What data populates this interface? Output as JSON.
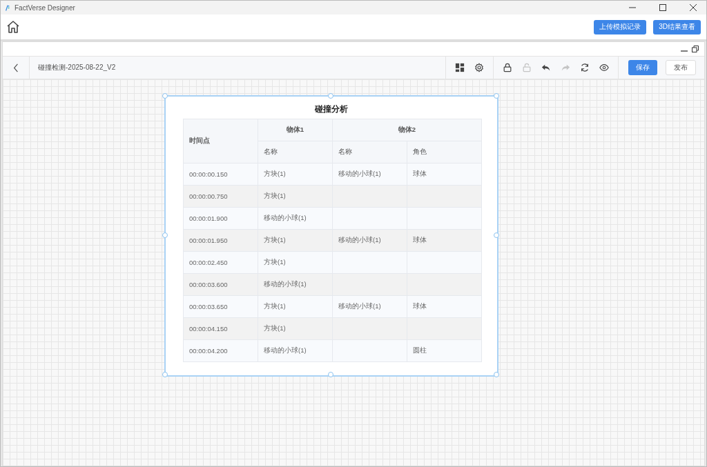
{
  "window": {
    "title": "FactVerse Designer"
  },
  "header": {
    "buttons": [
      "上传模拟记录",
      "3D结果查看"
    ]
  },
  "toolbar": {
    "document_title": "碰撞检测-2025-08-22_V2",
    "tools": [
      {
        "kind": "layout",
        "disabled": false
      },
      {
        "kind": "settings",
        "disabled": false
      },
      {
        "kind": "lock",
        "disabled": false
      },
      {
        "kind": "unlock",
        "disabled": true
      },
      {
        "kind": "undo",
        "disabled": false
      },
      {
        "kind": "redo",
        "disabled": true
      },
      {
        "kind": "refresh",
        "disabled": false
      },
      {
        "kind": "preview",
        "disabled": false
      }
    ],
    "save_button": "保存",
    "publish_button": "发布"
  },
  "report": {
    "title": "碰撞分析",
    "table": {
      "time_header": "时间点",
      "group_headers": [
        "物体1",
        "物体2"
      ],
      "sub_headers": [
        "名称",
        "名称",
        "角色"
      ],
      "rows": [
        [
          "00:00:00.150",
          "方块(1)",
          "移动的小球(1)",
          "球体"
        ],
        [
          "00:00:00.750",
          "方块(1)",
          "",
          ""
        ],
        [
          "00:00:01.900",
          "移动的小球(1)",
          "",
          ""
        ],
        [
          "00:00:01.950",
          "方块(1)",
          "移动的小球(1)",
          "球体"
        ],
        [
          "00:00:02.450",
          "方块(1)",
          "",
          ""
        ],
        [
          "00:00:03.600",
          "移动的小球(1)",
          "",
          ""
        ],
        [
          "00:00:03.650",
          "方块(1)",
          "移动的小球(1)",
          "球体"
        ],
        [
          "00:00:04.150",
          "方块(1)",
          "",
          ""
        ],
        [
          "00:00:04.200",
          "移动的小球(1)",
          "",
          "圆柱"
        ]
      ]
    }
  }
}
